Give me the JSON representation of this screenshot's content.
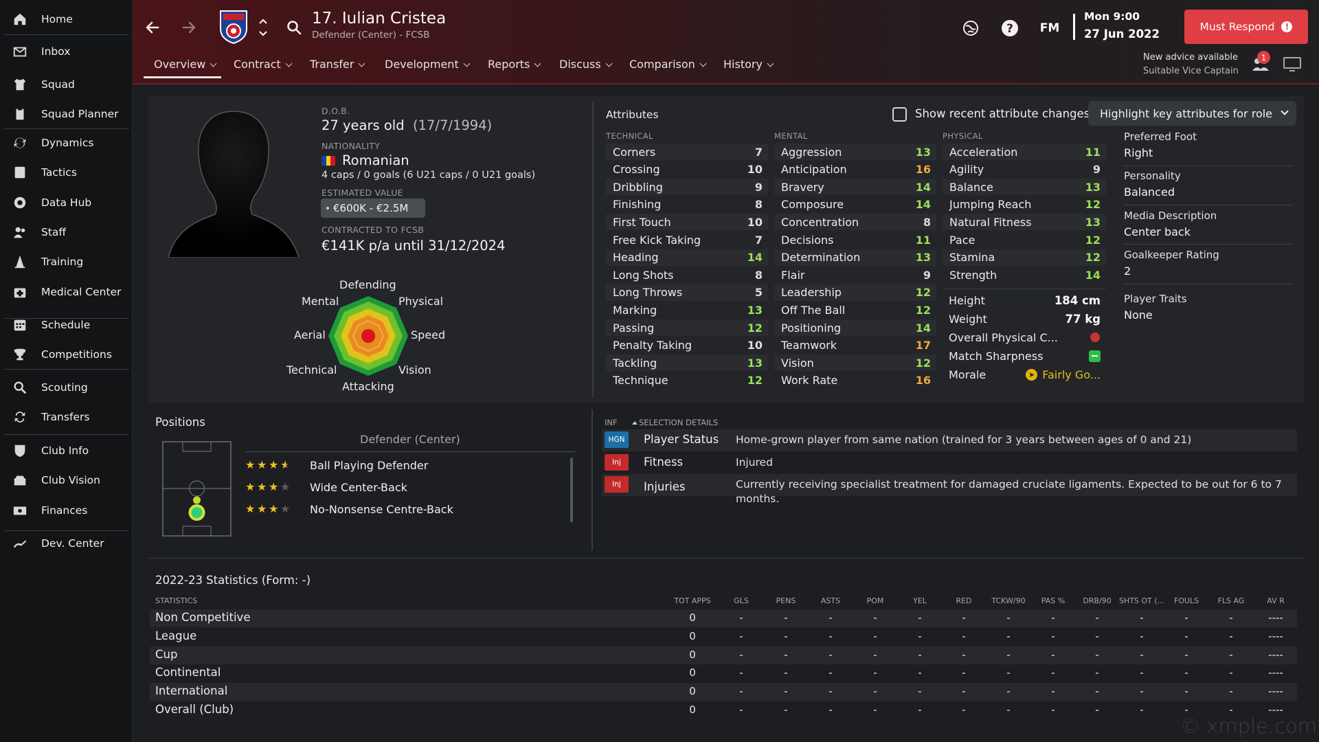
{
  "sidebar": {
    "items": [
      {
        "label": "Home",
        "icon": "home-icon"
      },
      {
        "label": "Inbox",
        "icon": "inbox-icon"
      },
      {
        "label": "Squad",
        "icon": "shirt-icon"
      },
      {
        "label": "Squad Planner",
        "icon": "clipboard-icon"
      },
      {
        "label": "Dynamics",
        "icon": "dynamics-icon"
      },
      {
        "label": "Tactics",
        "icon": "tactics-board-icon"
      },
      {
        "label": "Data Hub",
        "icon": "data-hub-icon"
      },
      {
        "label": "Staff",
        "icon": "staff-icon"
      },
      {
        "label": "Training",
        "icon": "training-cone-icon"
      },
      {
        "label": "Medical Center",
        "icon": "medical-kit-icon"
      },
      {
        "label": "Schedule",
        "icon": "calendar-icon"
      },
      {
        "label": "Competitions",
        "icon": "trophy-icon"
      },
      {
        "label": "Scouting",
        "icon": "search-icon"
      },
      {
        "label": "Transfers",
        "icon": "transfer-arrows-icon"
      },
      {
        "label": "Club Info",
        "icon": "shield-icon"
      },
      {
        "label": "Club Vision",
        "icon": "club-vision-icon"
      },
      {
        "label": "Finances",
        "icon": "money-icon"
      },
      {
        "label": "Dev. Center",
        "icon": "dev-center-icon"
      }
    ]
  },
  "header": {
    "player_title": "17. Iulian Cristea",
    "player_sub": "Defender (Center) - FCSB",
    "fm_label": "FM",
    "date_line1": "Mon 9:00",
    "date_line2": "27 Jun 2022",
    "must_respond": "Must Respond",
    "advice_line1": "New advice available",
    "advice_line2": "Suitable Vice Captain",
    "advice_count": "1",
    "tabs": [
      {
        "label": "Overview"
      },
      {
        "label": "Contract"
      },
      {
        "label": "Transfer"
      },
      {
        "label": "Development"
      },
      {
        "label": "Reports"
      },
      {
        "label": "Discuss"
      },
      {
        "label": "Comparison"
      },
      {
        "label": "History"
      }
    ]
  },
  "profile": {
    "dob_label": "D.O.B.",
    "age": "27 years old",
    "dob": "(17/7/1994)",
    "nationality_label": "NATIONALITY",
    "nationality": "Romanian",
    "caps": "4 caps / 0 goals (6 U21 caps / 0 U21 goals)",
    "value_label": "ESTIMATED VALUE",
    "value": "€600K - €2.5M",
    "contract_label": "CONTRACTED TO FCSB",
    "contract": "€141K p/a until 31/12/2024",
    "radar_labels": {
      "defending": "Defending",
      "physical": "Physical",
      "speed": "Speed",
      "vision": "Vision",
      "attacking": "Attacking",
      "technical": "Technical",
      "aerial": "Aerial",
      "mental": "Mental"
    }
  },
  "attributes": {
    "title": "Attributes",
    "show_changes": "Show recent attribute changes",
    "highlight": "Highlight key attributes for role",
    "technical_head": "TECHNICAL",
    "mental_head": "MENTAL",
    "physical_head": "PHYSICAL",
    "technical": [
      {
        "name": "Corners",
        "value": "7"
      },
      {
        "name": "Crossing",
        "value": "10"
      },
      {
        "name": "Dribbling",
        "value": "9"
      },
      {
        "name": "Finishing",
        "value": "8"
      },
      {
        "name": "First Touch",
        "value": "10"
      },
      {
        "name": "Free Kick Taking",
        "value": "7"
      },
      {
        "name": "Heading",
        "value": "14"
      },
      {
        "name": "Long Shots",
        "value": "8"
      },
      {
        "name": "Long Throws",
        "value": "5"
      },
      {
        "name": "Marking",
        "value": "13"
      },
      {
        "name": "Passing",
        "value": "12"
      },
      {
        "name": "Penalty Taking",
        "value": "10"
      },
      {
        "name": "Tackling",
        "value": "13"
      },
      {
        "name": "Technique",
        "value": "12"
      }
    ],
    "mental": [
      {
        "name": "Aggression",
        "value": "13"
      },
      {
        "name": "Anticipation",
        "value": "16"
      },
      {
        "name": "Bravery",
        "value": "14"
      },
      {
        "name": "Composure",
        "value": "14"
      },
      {
        "name": "Concentration",
        "value": "8"
      },
      {
        "name": "Decisions",
        "value": "11"
      },
      {
        "name": "Determination",
        "value": "13"
      },
      {
        "name": "Flair",
        "value": "9"
      },
      {
        "name": "Leadership",
        "value": "12"
      },
      {
        "name": "Off The Ball",
        "value": "12"
      },
      {
        "name": "Positioning",
        "value": "14"
      },
      {
        "name": "Teamwork",
        "value": "17"
      },
      {
        "name": "Vision",
        "value": "12"
      },
      {
        "name": "Work Rate",
        "value": "16"
      }
    ],
    "physical": [
      {
        "name": "Acceleration",
        "value": "11"
      },
      {
        "name": "Agility",
        "value": "9"
      },
      {
        "name": "Balance",
        "value": "13"
      },
      {
        "name": "Jumping Reach",
        "value": "12"
      },
      {
        "name": "Natural Fitness",
        "value": "13"
      },
      {
        "name": "Pace",
        "value": "12"
      },
      {
        "name": "Stamina",
        "value": "12"
      },
      {
        "name": "Strength",
        "value": "14"
      }
    ],
    "height_label": "Height",
    "height": "184 cm",
    "weight_label": "Weight",
    "weight": "77 kg",
    "condition_label": "Overall Physical C...",
    "sharpness_label": "Match Sharpness",
    "morale_label": "Morale",
    "morale": "Fairly Go..."
  },
  "side": {
    "foot_label": "Preferred Foot",
    "foot": "Right",
    "personality_label": "Personality",
    "personality": "Balanced",
    "media_label": "Media Description",
    "media": "Center back",
    "gk_label": "Goalkeeper Rating",
    "gk": "2",
    "traits_label": "Player Traits",
    "traits": "None"
  },
  "positions": {
    "title": "Positions",
    "sub": "Defender (Center)",
    "roles": [
      {
        "name": "Ball Playing Defender",
        "stars": 3.5
      },
      {
        "name": "Wide Center-Back",
        "stars": 3
      },
      {
        "name": "No-Nonsense Centre-Back",
        "stars": 3
      }
    ]
  },
  "selection": {
    "inf_head": "INF",
    "details_head": "SELECTION DETAILS",
    "rows": [
      {
        "badge": "HGN",
        "key": "Player Status",
        "value": "Home-grown player from same nation (trained for 3 years between ages of 0 and 21)"
      },
      {
        "badge": "Inj",
        "key": "Fitness",
        "value": "Injured"
      },
      {
        "badge": "Inj",
        "key": "Injuries",
        "value": "Currently receiving specialist treatment for damaged cruciate ligaments. Expected to be out for 6 to 7 months."
      }
    ]
  },
  "stats": {
    "title": "2022-23 Statistics (Form: -)",
    "label_head": "STATISTICS",
    "columns": [
      "TOT APPS",
      "GLS",
      "PENS",
      "ASTS",
      "POM",
      "YEL",
      "RED",
      "TCKW/90",
      "PAS %",
      "DRB/90",
      "SHTS OT (...",
      "FOULS",
      "FLS AG",
      "AV R"
    ],
    "rows": [
      {
        "label": "Non Competitive",
        "cells": [
          "0",
          "-",
          "-",
          "-",
          "-",
          "-",
          "-",
          "-",
          "-",
          "-",
          "-",
          "-",
          "-",
          "----"
        ]
      },
      {
        "label": "League",
        "cells": [
          "0",
          "-",
          "-",
          "-",
          "-",
          "-",
          "-",
          "-",
          "-",
          "-",
          "-",
          "-",
          "-",
          "----"
        ]
      },
      {
        "label": "Cup",
        "cells": [
          "0",
          "-",
          "-",
          "-",
          "-",
          "-",
          "-",
          "-",
          "-",
          "-",
          "-",
          "-",
          "-",
          "----"
        ]
      },
      {
        "label": "Continental",
        "cells": [
          "0",
          "-",
          "-",
          "-",
          "-",
          "-",
          "-",
          "-",
          "-",
          "-",
          "-",
          "-",
          "-",
          "----"
        ]
      },
      {
        "label": "International",
        "cells": [
          "0",
          "-",
          "-",
          "-",
          "-",
          "-",
          "-",
          "-",
          "-",
          "-",
          "-",
          "-",
          "-",
          "----"
        ]
      },
      {
        "label": "Overall (Club)",
        "cells": [
          "0",
          "-",
          "-",
          "-",
          "-",
          "-",
          "-",
          "-",
          "-",
          "-",
          "-",
          "-",
          "-",
          "----"
        ]
      }
    ]
  },
  "watermark": "© xmple.com",
  "colors": {
    "accent_red": "#e03e45",
    "attr_high": "#9be05a",
    "attr_orange": "#f2a83a",
    "star": "#f0c020"
  }
}
